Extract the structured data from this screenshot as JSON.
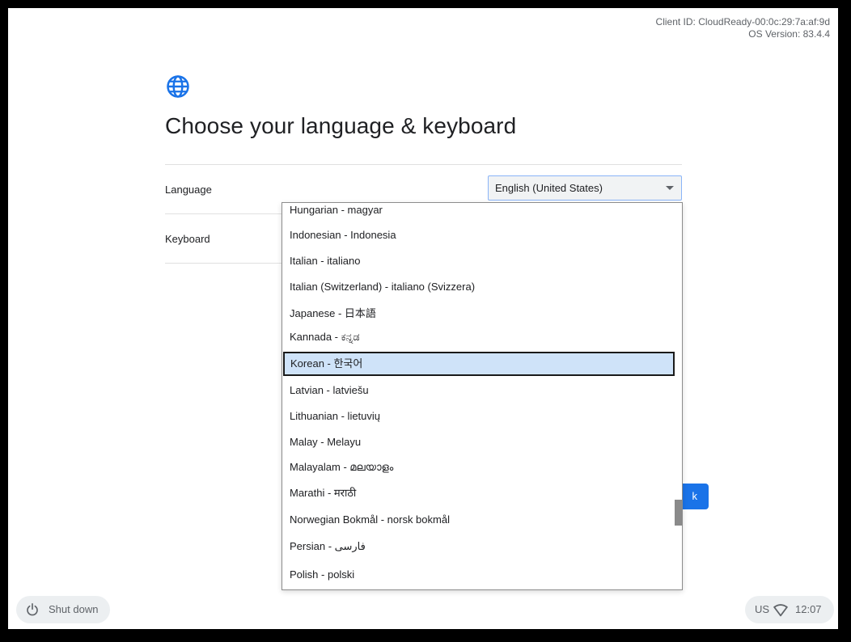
{
  "client_info": {
    "client_id": "Client ID: CloudReady-00:0c:29:7a:af:9d",
    "os_version": "OS Version: 83.4.4"
  },
  "title": "Choose your language & keyboard",
  "language_row": {
    "label": "Language",
    "selected_value": "English (United States)"
  },
  "keyboard_row": {
    "label": "Keyboard"
  },
  "next_button": {
    "label": "k"
  },
  "dropdown": {
    "options": [
      "Hungarian - magyar",
      "Indonesian - Indonesia",
      "Italian - italiano",
      "Italian (Switzerland) - italiano (Svizzera)",
      "Japanese - 日本語",
      "Kannada - ಕನ್ನಡ",
      "Korean - 한국어",
      "Latvian - latviešu",
      "Lithuanian - lietuvių",
      "Malay - Melayu",
      "Malayalam - മലയാളം",
      "Marathi - मराठी",
      "Norwegian Bokmål - norsk bokmål",
      "Persian - فارسی",
      "Polish - polski"
    ],
    "highlighted": "Korean - 한국어"
  },
  "shelf": {
    "shutdown_label": "Shut down",
    "keyboard_layout": "US",
    "time": "12:07"
  },
  "colors": {
    "accent": "#1a73e8",
    "highlight": "#cfe3f9"
  },
  "icons": [
    "globe-icon",
    "dropdown-caret-icon",
    "power-icon",
    "wifi-icon"
  ]
}
